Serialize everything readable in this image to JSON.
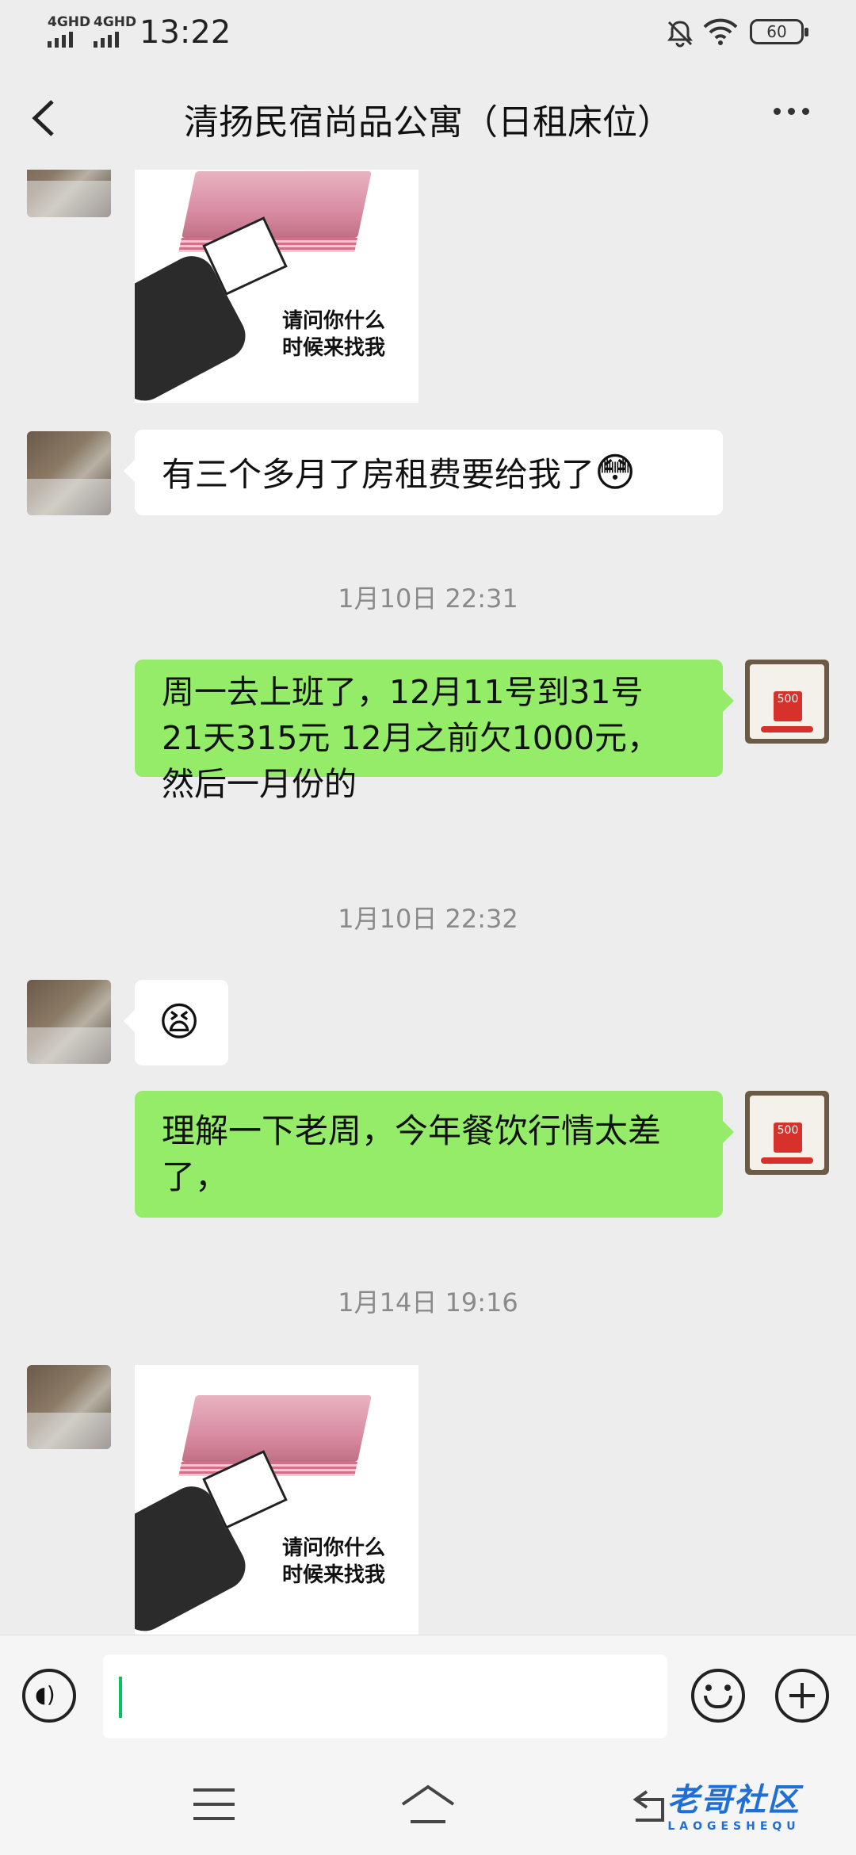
{
  "status_bar": {
    "signal1": "4GHD",
    "signal2": "4GHD",
    "time": "13:22",
    "battery": "60"
  },
  "header": {
    "title": "清扬民宿尚品公寓（日租床位）"
  },
  "messages": {
    "m1_sticker_text": "请问你什么\n时候来找我",
    "m2_text": "有三个多月了房租费要给我了",
    "m2_emoji": "😳",
    "ts1": "1月10日 22:31",
    "m3_text": "周一去上班了，12月11号到31号\n21天315元  12月之前欠1000元，\n然后一月份的",
    "ts2": "1月10日 22:32",
    "m4_emoji": "😫",
    "m5_text": "理解一下老周，今年餐饮行情太差\n了，",
    "ts3": "1月14日 19:16",
    "m6_sticker_text": "请问你什么\n时候来找我"
  },
  "avatar_me": {
    "tag_text": "500"
  },
  "watermark": {
    "main": "老哥社区",
    "sub": "LAOGESHEQU"
  },
  "colors": {
    "background": "#ededed",
    "my_bubble": "#95ec69",
    "their_bubble": "#ffffff",
    "cursor": "#07c160"
  }
}
